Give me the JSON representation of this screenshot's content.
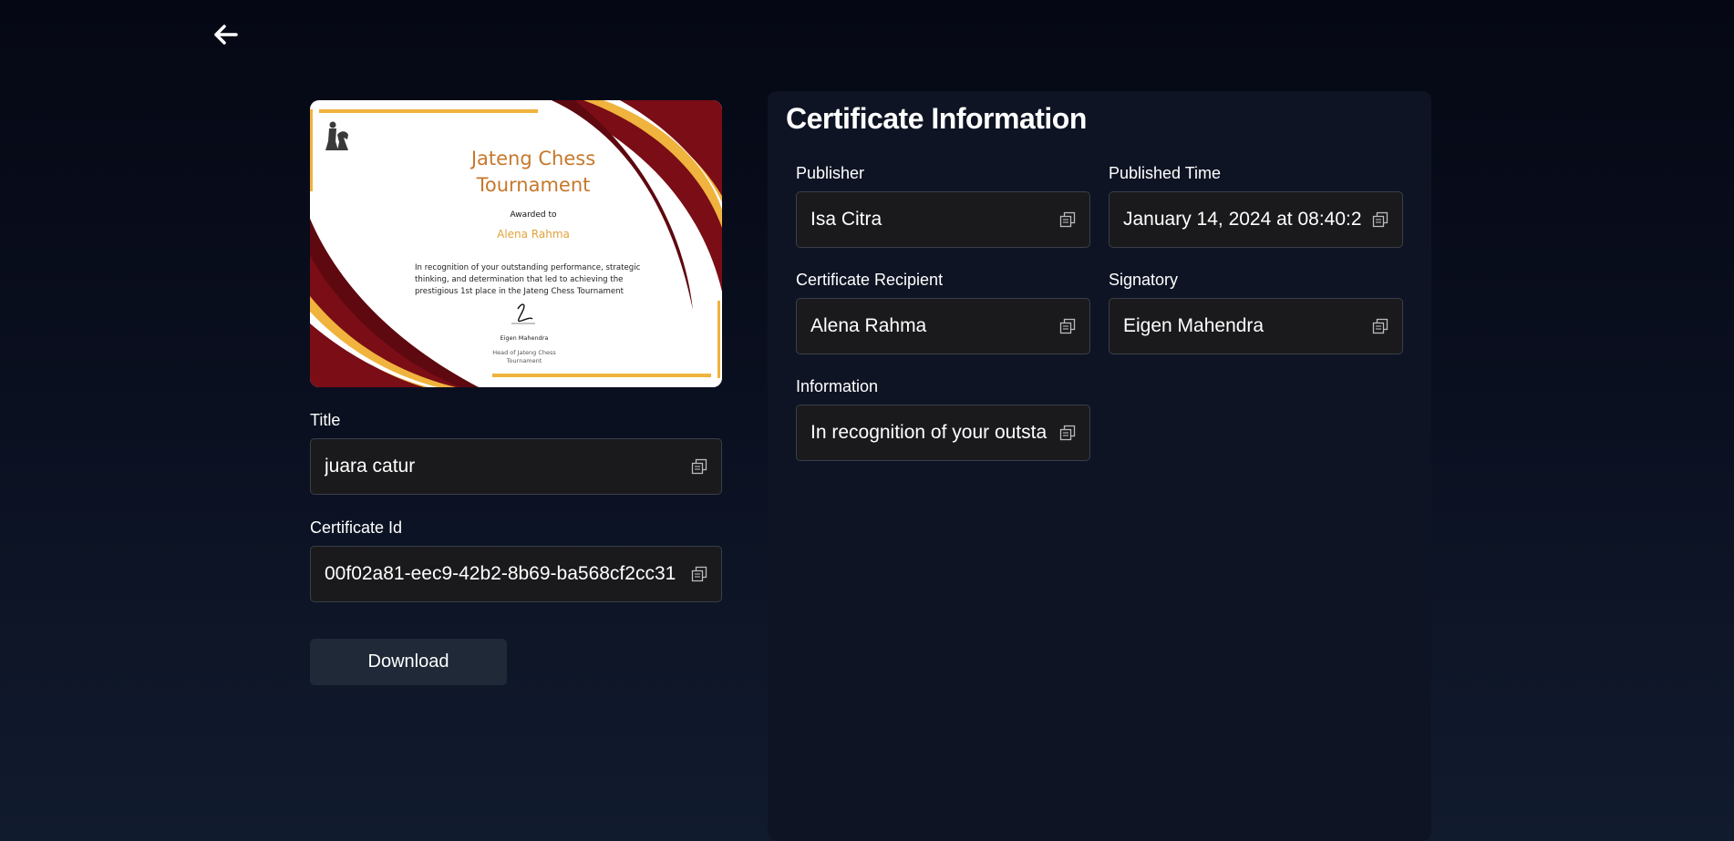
{
  "nav": {
    "back_icon": "arrow-left-icon"
  },
  "certificate_preview": {
    "title_line1": "Jateng Chess",
    "title_line2": "Tournament",
    "awarded_label": "Awarded to",
    "recipient": "Alena Rahma",
    "body": "In recognition of your outstanding performance, strategic thinking, and determination that led to achieving the prestigious 1st place in the Jateng Chess Tournament",
    "signer_name": "Eigen Mahendra",
    "signer_role": "Head of Jateng Chess Tournament",
    "colors": {
      "maroon": "#7a0d16",
      "gold": "#f0b33d",
      "title": "#c6782c"
    }
  },
  "left": {
    "title_label": "Title",
    "title_value": "juara catur",
    "cert_id_label": "Certificate Id",
    "cert_id_value": "00f02a81-eec9-42b2-8b69-ba568cf2cc31",
    "download_label": "Download"
  },
  "info": {
    "heading": "Certificate Information",
    "publisher_label": "Publisher",
    "publisher_value": "Isa Citra",
    "published_time_label": "Published Time",
    "published_time_value": "January 14, 2024 at 08:40:2",
    "recipient_label": "Certificate Recipient",
    "recipient_value": "Alena Rahma",
    "signatory_label": "Signatory",
    "signatory_value": "Eigen Mahendra",
    "information_label": "Information",
    "information_value": "In recognition of your outsta"
  },
  "icons": {
    "copy": "copy-icon"
  },
  "theme": {
    "background": "#050814",
    "panel": "#0f1424",
    "field": "#1a1a1c",
    "button": "#1f2937"
  }
}
